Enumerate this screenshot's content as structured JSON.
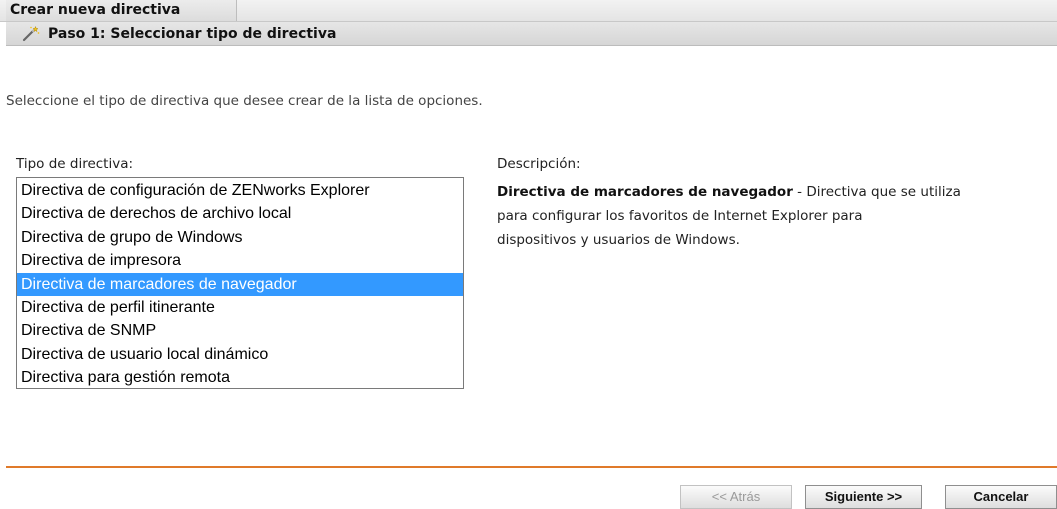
{
  "header": {
    "tab_title": "Crear nueva directiva",
    "step_title": "Paso 1: Seleccionar tipo de directiva",
    "step_icon": "wand-icon"
  },
  "instructions": "Seleccione el tipo de directiva que desee crear de la lista de opciones.",
  "policy_types": {
    "label": "Tipo de directiva:",
    "items": [
      {
        "label": "Directiva de configuración de ZENworks Explorer",
        "selected": false
      },
      {
        "label": "Directiva de derechos de archivo local",
        "selected": false
      },
      {
        "label": "Directiva de grupo de Windows",
        "selected": false
      },
      {
        "label": "Directiva de impresora",
        "selected": false
      },
      {
        "label": "Directiva de marcadores de navegador",
        "selected": true
      },
      {
        "label": "Directiva de perfil itinerante",
        "selected": false
      },
      {
        "label": "Directiva de SNMP",
        "selected": false
      },
      {
        "label": "Directiva de usuario local dinámico",
        "selected": false
      },
      {
        "label": "Directiva para gestión remota",
        "selected": false
      }
    ],
    "selected_color": "#3399ff"
  },
  "description": {
    "label": "Descripción:",
    "name": "Directiva de marcadores de navegador",
    "text_line1": " - Directiva que se utiliza",
    "text_line2": "para configurar los favoritos de Internet Explorer para",
    "text_line3": "dispositivos y usuarios de Windows."
  },
  "footer": {
    "accent_color": "#e07a2a",
    "back_label": "<< Atrás",
    "next_label": "Siguiente >>",
    "cancel_label": "Cancelar"
  }
}
